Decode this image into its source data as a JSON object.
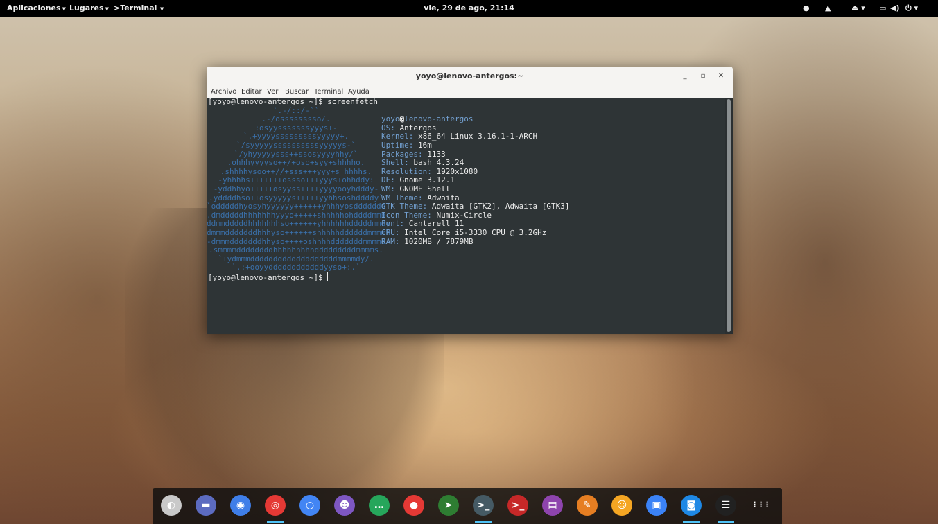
{
  "topbar": {
    "applications": "Aplicaciones",
    "places": "Lugares",
    "app_menu": "Terminal",
    "clock": "vie, 29 de ago, 21:14"
  },
  "window": {
    "title": "yoyo@lenovo-antergos:~",
    "menu": [
      "Archivo",
      "Editar",
      "Ver",
      "Buscar",
      "Terminal",
      "Ayuda"
    ]
  },
  "terminal": {
    "prompt": "[yoyo@lenovo-antergos ~]$ screenfetch",
    "prompt2": "[yoyo@lenovo-antergos ~]$ ",
    "logo": [
      "`.-/::/-``",
      ".-/osssssssso/.",
      ":osyysssssssyyys+-",
      "`.+yyyysssssssssyyyyy+.",
      "`/syyyyyssssssssssyyyyys-`",
      "`/yhyyyyysss++ssosyyyyhhy/`",
      ".ohhhyyyyso++/+oso+syy+shhhho.",
      ".shhhhysoo++//+sss+++yyy+s hhhhs.",
      "-yhhhhs+++++++ossso+++yyys+ohhddy:",
      "-yddhhyo+++++osyyss++++yyyyooyhdddy-",
      ".yddddhso++osyyyyys+++++yyhhsoshddddy`",
      "`odddddhyosyhyyyyyy++++++yhhhyosddddddo",
      ".dmdddddhhhhhhhyyyo+++++shhhhhohddddmmh.",
      "ddmmdddddhhhhhhhso++++++yhhhhhhdddddmmdy",
      "dmmmdddddddhhhyso++++++shhhhhddddddmmmmh",
      "-dmmmdddddddhhyso++++oshhhhdddddddmmmmd-",
      ".smmmmddddddddhhhhhhhhhdddddddddmmmms.",
      "`+ydmmmdddddddddddddddddddmmmmdy/.",
      "`.:+ooyyddddddddddddyyso+:.`"
    ],
    "info": [
      {
        "key": "",
        "value": "yoyo@lenovo-antergos"
      },
      {
        "key": "OS:",
        "value": " Antergos"
      },
      {
        "key": "Kernel:",
        "value": " x86_64 Linux 3.16.1-1-ARCH"
      },
      {
        "key": "Uptime:",
        "value": " 16m"
      },
      {
        "key": "Packages:",
        "value": " 1133"
      },
      {
        "key": "Shell:",
        "value": " bash 4.3.24"
      },
      {
        "key": "Resolution:",
        "value": " 1920x1080"
      },
      {
        "key": "DE:",
        "value": " Gnome 3.12.1"
      },
      {
        "key": "WM:",
        "value": " GNOME Shell"
      },
      {
        "key": "WM Theme:",
        "value": " Adwaita"
      },
      {
        "key": "GTK Theme:",
        "value": " Adwaita [GTK2], Adwaita [GTK3]"
      },
      {
        "key": "Icon Theme:",
        "value": " Numix-Circle"
      },
      {
        "key": "Font:",
        "value": " Cantarell 11"
      },
      {
        "key": "CPU:",
        "value": " Intel Core i5-3330 CPU @ 3.2GHz"
      },
      {
        "key": "RAM:",
        "value": " 1020MB / 7879MB"
      }
    ]
  },
  "dock": [
    {
      "icon": "settings-toggle-icon",
      "color": "#c9c9c9",
      "glyph": "◐",
      "running": false
    },
    {
      "icon": "files-icon",
      "color": "#5c6bc0",
      "glyph": "▬",
      "running": false
    },
    {
      "icon": "firefox-icon",
      "color": "#3f7ee8",
      "glyph": "◉",
      "running": false
    },
    {
      "icon": "chrome-icon",
      "color": "#e53935",
      "glyph": "◎",
      "running": true
    },
    {
      "icon": "chromium-icon",
      "color": "#4285f4",
      "glyph": "○",
      "running": false
    },
    {
      "icon": "pidgin-icon",
      "color": "#7e57c2",
      "glyph": "☻",
      "running": false
    },
    {
      "icon": "chat-icon",
      "color": "#26a65b",
      "glyph": "…",
      "running": false
    },
    {
      "icon": "sound-recorder-icon",
      "color": "#e53935",
      "glyph": "●",
      "running": false
    },
    {
      "icon": "shortcut-icon",
      "color": "#2e7d32",
      "glyph": "➤",
      "running": false
    },
    {
      "icon": "terminal-icon",
      "color": "#455a64",
      "glyph": ">_",
      "running": true
    },
    {
      "icon": "terminal-red-icon",
      "color": "#c62828",
      "glyph": ">_",
      "running": false
    },
    {
      "icon": "text-editor-icon",
      "color": "#8e44ad",
      "glyph": "▤",
      "running": false
    },
    {
      "icon": "gimp-icon",
      "color": "#e67e22",
      "glyph": "✎",
      "running": false
    },
    {
      "icon": "ghost-icon",
      "color": "#f5a623",
      "glyph": "☺",
      "running": false
    },
    {
      "icon": "toggle-icon",
      "color": "#3b82f6",
      "glyph": "▣",
      "running": false
    },
    {
      "icon": "screenshot-icon",
      "color": "#1e88e5",
      "glyph": "◙",
      "running": true
    },
    {
      "icon": "task-list-icon",
      "color": "#212121",
      "glyph": "☰",
      "running": true
    },
    {
      "icon": "app-grid-icon",
      "color": "transparent",
      "glyph": "⋮⋮⋮",
      "running": false
    }
  ]
}
